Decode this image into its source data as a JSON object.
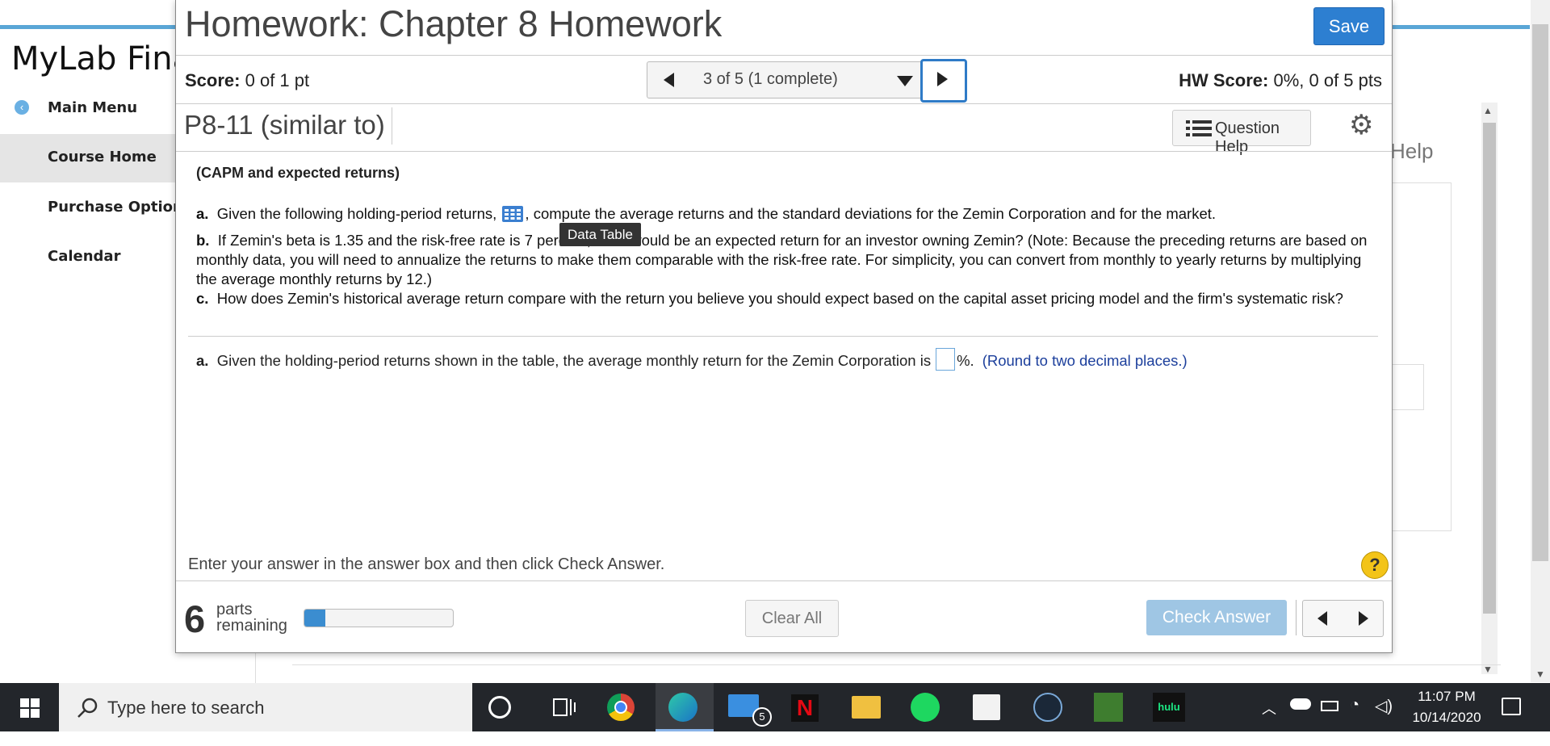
{
  "background_app": {
    "brand": "MyLab Fina",
    "nav": {
      "main_menu": "Main Menu",
      "course_home": "Course Home",
      "purchase_options": "Purchase Options",
      "calendar": "Calendar"
    },
    "help_link": "Help"
  },
  "dialog": {
    "title": "Homework: Chapter 8 Homework",
    "save_label": "Save",
    "score_label": "Score:",
    "score_value": "0 of 1 pt",
    "question_position": "3 of 5 (1 complete)",
    "hw_score_label": "HW Score:",
    "hw_score_value": "0%, 0 of 5 pts",
    "question_id": "P8-11 (similar to)",
    "question_help_label": "Question Help"
  },
  "problem": {
    "heading": "(CAPM and expected returns)",
    "part_a_label": "a.",
    "part_a_text_1": "Given the following holding-period returns,",
    "part_a_text_2": ", compute the average returns and the standard deviations for the Zemin Corporation and for the market.",
    "part_b_label": "b.",
    "part_b_text": "If Zemin's beta is 1.35 and the risk-free rate is 7 percent, what would be an expected return for an investor owning Zemin?  (Note: Because the preceding returns are based on monthly data, you will need to annualize the returns to make them comparable with the risk-free rate.  For simplicity, you can convert from monthly to yearly returns by multiplying the average monthly returns by 12.)",
    "part_c_label": "c.",
    "part_c_text": "How does Zemin's historical average return compare with the return you believe you should expect based on the capital asset pricing model and the firm's systematic risk?",
    "tooltip": "Data Table"
  },
  "answer": {
    "label": "a.",
    "prompt": "Given the holding-period returns shown in the table, the average monthly return for the Zemin Corporation is",
    "unit": "%.",
    "value": "",
    "hint": "(Round to two decimal places.)"
  },
  "footer": {
    "instruction": "Enter your answer in the answer box and then click Check Answer.",
    "help_glyph": "?",
    "parts_remaining_count": "6",
    "parts_remaining_label_1": "parts",
    "parts_remaining_label_2": "remaining",
    "progress_fraction": 0.14,
    "clear_all_label": "Clear All",
    "check_answer_label": "Check Answer"
  },
  "taskbar": {
    "search_placeholder": "Type here to search",
    "mail_badge": "5",
    "netflix_glyph": "N",
    "hulu_label": "hulu",
    "time": "11:07 PM",
    "date": "10/14/2020"
  },
  "colors": {
    "accent": "#2d7fd1",
    "check_answer_disabled": "#9fc6e4",
    "hint_text": "#1c3f9c",
    "help_circle": "#f3c419"
  }
}
